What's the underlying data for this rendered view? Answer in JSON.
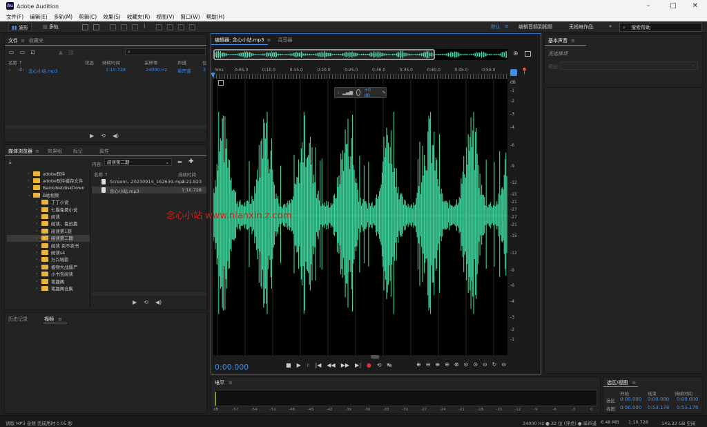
{
  "window": {
    "title": "Adobe Audition",
    "app_icon": "Au"
  },
  "menu": [
    "文件(F)",
    "编辑(E)",
    "多轨(M)",
    "剪辑(C)",
    "效果(S)",
    "收藏夹(R)",
    "视图(V)",
    "窗口(W)",
    "帮助(H)"
  ],
  "toolbar": {
    "waveform": "波形",
    "multitrack": "多轨",
    "workspace_default": "默认",
    "ws_edit_video": "编辑音频到视频",
    "ws_radio": "无线电作品",
    "search": "搜索帮助"
  },
  "files_panel": {
    "tabs": [
      "文件",
      "收藏夹"
    ],
    "columns": [
      "名称 ↑",
      "状态",
      "持续时间",
      "采样率",
      "声道",
      "位"
    ],
    "file": {
      "name": "念心小站.mp3",
      "duration": "1:10.728",
      "sample_rate": "24000 Hz",
      "channels": "单声道",
      "bits": "3"
    }
  },
  "media_browser": {
    "tabs": [
      "媒体浏览器",
      "效果组",
      "标记",
      "属性"
    ],
    "content_label": "内容:",
    "content_value": "阅读第二期",
    "columns": [
      "名称 ↑",
      "持续时间"
    ],
    "files": [
      {
        "name": "Screenr...20230914_162639.mp4",
        "duration": "2:21.823"
      },
      {
        "name": "念心小站.mp3",
        "duration": "1:10.728"
      }
    ],
    "folders": [
      {
        "name": "adobe软件",
        "level": 1
      },
      {
        "name": "adobe软件缓存文件",
        "level": 1
      },
      {
        "name": "BaiduNetdiskDown",
        "level": 1
      },
      {
        "name": "B站视频",
        "level": 1,
        "open": true
      },
      {
        "name": "丁丁小说",
        "level": 2
      },
      {
        "name": "七猫免费小说",
        "level": 2
      },
      {
        "name": "阅读",
        "level": 2
      },
      {
        "name": "阅读、鲁迅篇",
        "level": 2
      },
      {
        "name": "阅读第1期",
        "level": 2
      },
      {
        "name": "阅读第二期",
        "level": 2,
        "selected": true
      },
      {
        "name": "阅读 卖不卖书",
        "level": 2
      },
      {
        "name": "阅读s4",
        "level": 2
      },
      {
        "name": "万兴喵影",
        "level": 2
      },
      {
        "name": "植物大战僵尸",
        "level": 2
      },
      {
        "name": "小书包阅读",
        "level": 2
      },
      {
        "name": "笔趣阁",
        "level": 2
      },
      {
        "name": "笔趣阁合集",
        "level": 2
      }
    ]
  },
  "history_panel": {
    "tabs": [
      "历史记录",
      "视频"
    ]
  },
  "editor": {
    "tabs": [
      "编辑器: 念心小站.mp3",
      "混音器"
    ],
    "time": "0:00.000",
    "hud_db": "+0 dB",
    "ruler_unit": "hms",
    "ruler": [
      "0:05.0",
      "0:10.0",
      "0:15.0",
      "0:20.0",
      "0:25.0",
      "0:30.0",
      "0:35.0",
      "0:40.0",
      "0:45.0",
      "0:50.0"
    ],
    "db_labels": [
      "dB",
      "-1",
      "-2",
      "-3",
      "-4",
      "-6",
      "-9",
      "-12",
      "-15",
      "-21",
      "-27",
      "-27",
      "-21",
      "-15",
      "-12",
      "-9",
      "-6",
      "-4",
      "-3",
      "-2",
      "-1"
    ],
    "watermark": "念心小站 www.nianxin.z.com",
    "wave_color": "#3ed39a"
  },
  "essential_sound": {
    "title": "基本声音",
    "no_selection": "无选择项",
    "preset_label": "预设:"
  },
  "level_panel": {
    "title": "电平",
    "scale": [
      "dB",
      "-57",
      "-54",
      "-51",
      "-48",
      "-45",
      "-42",
      "-39",
      "-36",
      "-33",
      "-30",
      "-27",
      "-24",
      "-21",
      "-18",
      "-15",
      "-12",
      "-9",
      "-6",
      "-3",
      "0"
    ]
  },
  "selection_panel": {
    "title": "选区/视图",
    "headers": [
      "开始",
      "结束",
      "持续时间"
    ],
    "rows": [
      {
        "label": "选区",
        "start": "0:00.000",
        "end": "0:00.000",
        "dur": "0:00.000"
      },
      {
        "label": "视图",
        "start": "0:00.000",
        "end": "0:53.178",
        "dur": "0:53.178"
      }
    ]
  },
  "status": {
    "left": "读取 MP3 音频 完成用时 0.05 秒",
    "format": "24000 Hz ● 32 位 (浮点) ● 单声道",
    "size": "6.48 MB",
    "duration": "1:10.728",
    "free": "145.32 GB 空闲"
  }
}
